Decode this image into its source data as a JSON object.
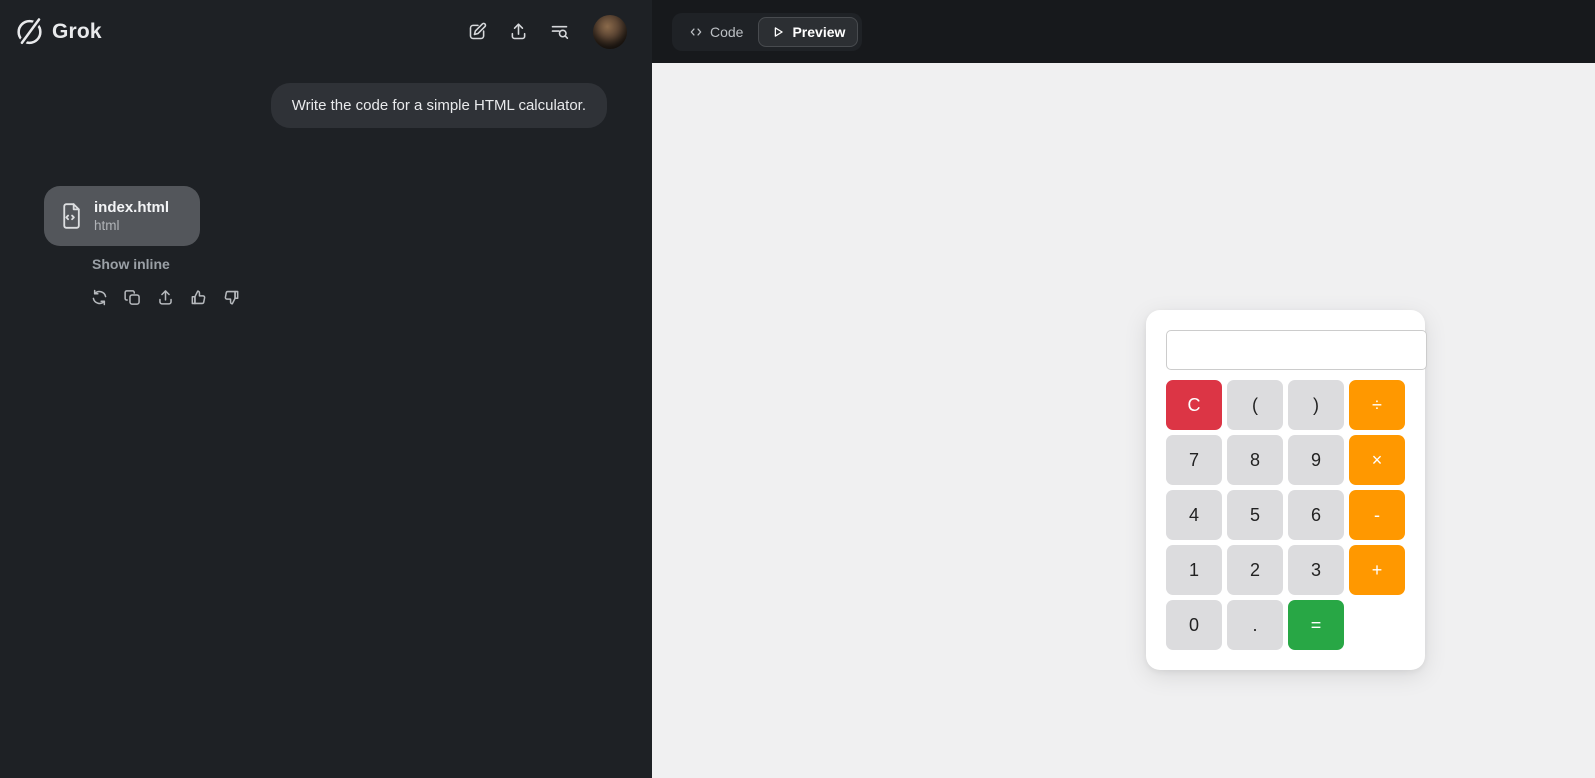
{
  "sidebar": {
    "brand": "Grok",
    "header_icons": [
      "compose-icon",
      "upload-icon",
      "history-search-icon",
      "user-avatar"
    ],
    "user_message": "Write the code for a simple HTML calculator.",
    "attachment": {
      "filename": "index.html",
      "filetype": "html",
      "icon": "code-file-icon"
    },
    "show_inline_label": "Show inline",
    "message_actions": [
      "regenerate",
      "copy",
      "share",
      "thumbs-up",
      "thumbs-down"
    ]
  },
  "workspace": {
    "tabs": [
      {
        "label": "Code",
        "icon": "code-icon",
        "active": false
      },
      {
        "label": "Preview",
        "icon": "play-icon",
        "active": true
      }
    ]
  },
  "calculator": {
    "display": {
      "value": "",
      "placeholder": ""
    },
    "buttons": [
      {
        "label": "C",
        "type": "clear"
      },
      {
        "label": "(",
        "type": "default"
      },
      {
        "label": ")",
        "type": "default"
      },
      {
        "label": "÷",
        "type": "operator"
      },
      {
        "label": "7",
        "type": "default"
      },
      {
        "label": "8",
        "type": "default"
      },
      {
        "label": "9",
        "type": "default"
      },
      {
        "label": "×",
        "type": "operator"
      },
      {
        "label": "4",
        "type": "default"
      },
      {
        "label": "5",
        "type": "default"
      },
      {
        "label": "6",
        "type": "default"
      },
      {
        "label": "-",
        "type": "operator"
      },
      {
        "label": "1",
        "type": "default"
      },
      {
        "label": "2",
        "type": "default"
      },
      {
        "label": "3",
        "type": "default"
      },
      {
        "label": "+",
        "type": "operator"
      },
      {
        "label": "0",
        "type": "default"
      },
      {
        "label": ".",
        "type": "default"
      },
      {
        "label": "=",
        "type": "equals"
      }
    ]
  },
  "colors": {
    "sidebar_bg": "#1e2125",
    "topbar_bg": "#17191c",
    "preview_bg": "#f0f0f1",
    "bubble_bg": "#2f3237",
    "attachment_bg": "#53565b",
    "clear_button": "#dc3545",
    "operator_button": "#ff9800",
    "equals_button": "#28a745",
    "digit_button": "#dcdcde"
  }
}
